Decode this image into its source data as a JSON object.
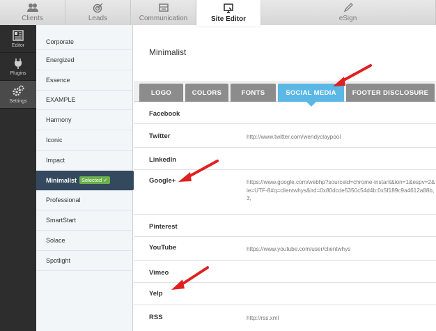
{
  "topnav": {
    "tabs": [
      {
        "label": "Clients",
        "icon": "users-icon"
      },
      {
        "label": "Leads",
        "icon": "target-icon"
      },
      {
        "label": "Communication",
        "icon": "envelope-icon"
      },
      {
        "label": "Site Editor",
        "icon": "monitor-icon",
        "active": true
      },
      {
        "label": "eSign",
        "icon": "pen-icon"
      }
    ]
  },
  "rail": {
    "items": [
      {
        "label": "Editor",
        "icon": "editor-icon"
      },
      {
        "label": "Plugins",
        "icon": "plug-icon"
      },
      {
        "label": "Settings",
        "icon": "gears-icon",
        "active": true
      }
    ]
  },
  "themes": {
    "items": [
      "Corporate",
      "Energized",
      "Essence",
      "EXAMPLE",
      "Harmony",
      "Iconic",
      "Impact",
      "Minimalist",
      "Professional",
      "SmartStart",
      "Solace",
      "Spotlight"
    ],
    "selected_index": 7,
    "selected_badge": "Selected"
  },
  "main": {
    "title": "Minimalist",
    "tabs": [
      "LOGO",
      "COLORS",
      "FONTS",
      "SOCIAL MEDIA",
      "FOOTER DISCLOSURE"
    ],
    "active_tab": 3,
    "social": [
      {
        "label": "Facebook",
        "value": ""
      },
      {
        "label": "Twitter",
        "value": "http://www.twitter.com/wendyclaypool"
      },
      {
        "label": "LinkedIn",
        "value": ""
      },
      {
        "label": "Google+",
        "value": "https://www.google.com/webhp?sourceid=chrome-instant&ion=1&espv=2&ie=UTF-8#q=clientwhys&lrd=0x80dcde5350c54d4b:0x5f189c9a4612a88b,3,"
      },
      {
        "label": "Pinterest",
        "value": ""
      },
      {
        "label": "YouTube",
        "value": "https://www.youtube.com/user/clientwhys"
      },
      {
        "label": "Vimeo",
        "value": ""
      },
      {
        "label": "Yelp",
        "value": ""
      },
      {
        "label": "RSS",
        "value": "http://rss.xml"
      }
    ]
  },
  "colors": {
    "accent": "#5bb7e5",
    "selected_bg": "#34495e",
    "badge": "#6ab04c",
    "annotation_arrow": "#e02020"
  }
}
